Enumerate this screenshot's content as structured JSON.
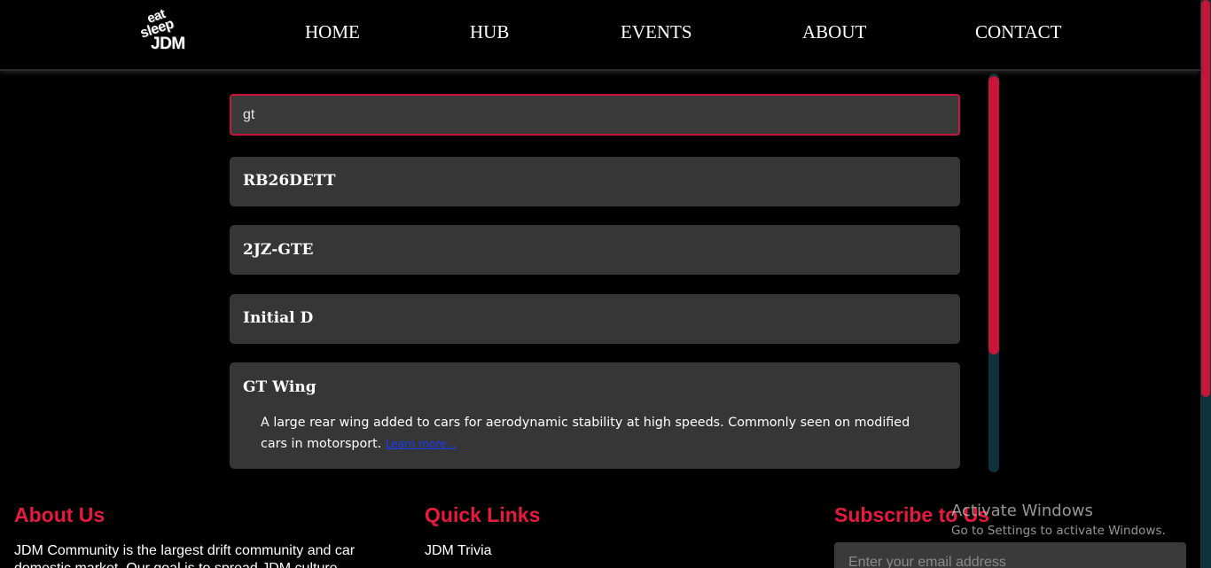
{
  "header": {
    "logo": {
      "line1": "eat",
      "line2": "sleep",
      "line3": "JDM"
    },
    "nav": [
      {
        "label": "HOME"
      },
      {
        "label": "HUB"
      },
      {
        "label": "EVENTS"
      },
      {
        "label": "ABOUT"
      },
      {
        "label": "CONTACT"
      }
    ]
  },
  "search": {
    "value": "gt"
  },
  "results": [
    {
      "title": "RB26DETT"
    },
    {
      "title": "2JZ-GTE"
    },
    {
      "title": "Initial D"
    },
    {
      "title": "GT Wing",
      "description": "A large rear wing added to cars for aerodynamic stability at high speeds. Commonly seen on modified cars in motorsport.",
      "link_label": "Learn more..."
    }
  ],
  "footer": {
    "about": {
      "heading": "About Us",
      "text": "JDM Community is the largest drift community and car domestic market. Our goal is to spread JDM culture"
    },
    "quick_links": {
      "heading": "Quick Links",
      "items": [
        {
          "label": "JDM Trivia"
        }
      ]
    },
    "subscribe": {
      "heading": "Subscribe to Us",
      "email_placeholder": "Enter your email address"
    }
  },
  "watermark": {
    "title": "Activate Windows",
    "subtitle": "Go to Settings to activate Windows."
  },
  "colors": {
    "accent": "#c8163a",
    "card_bg": "#363636",
    "background": "#000000",
    "scroll_track": "#10323c",
    "footer_heading": "#e6193f"
  }
}
